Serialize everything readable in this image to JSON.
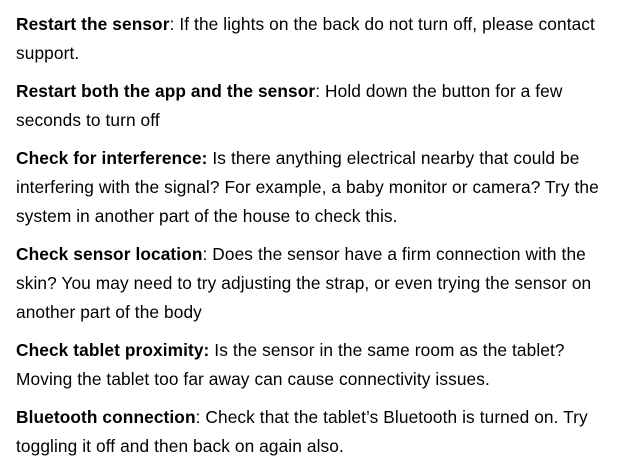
{
  "items": [
    {
      "heading": "Restart the sensor",
      "separator": ":",
      "text": " If the lights on the back do not turn off, please contact support."
    },
    {
      "heading": "Restart both the app and the sensor",
      "separator": ":",
      "text": " Hold down the button for a few seconds to turn off"
    },
    {
      "heading": "Check for interference:",
      "separator": "",
      "text": " Is there anything electrical nearby that could be interfering with the signal? For example, a baby monitor or camera? Try the system in another part of the house to check this."
    },
    {
      "heading": "Check sensor location",
      "separator": ":",
      "text": " Does the sensor have a firm connection with the skin? You may need to try adjusting the strap, or even trying the sensor on another part of the body"
    },
    {
      "heading": "Check tablet proximity:",
      "separator": "",
      "text": " Is the sensor in the same room as the tablet? Moving the tablet too far away can cause connectivity issues."
    },
    {
      "heading": "Bluetooth connection",
      "separator": ":",
      "text": " Check that the tablet’s Bluetooth is turned on. Try toggling it off and then back on again also."
    }
  ]
}
